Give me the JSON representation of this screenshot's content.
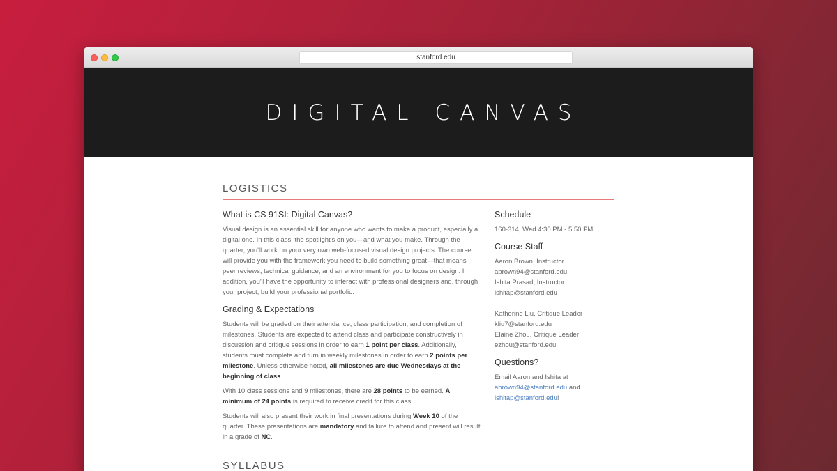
{
  "browser": {
    "url": "stanford.edu"
  },
  "hero": {
    "title": "DIGITAL CANVAS"
  },
  "logistics": {
    "section_title": "LOGISTICS",
    "what_is": {
      "heading": "What is CS 91SI: Digital Canvas?",
      "body": "Visual design is an essential skill for anyone who wants to make a product, especially a digital one. In this class, the spotlight's on you—and what you make. Through the quarter, you'll work on your very own web-focused visual design projects. The course will provide you with the framework you need to build something great—that means peer reviews, technical guidance, and an environment for you to focus on design. In addition, you'll have the opportunity to interact with professional designers and, through your project, build your professional portfolio."
    },
    "grading": {
      "heading": "Grading & Expectations",
      "p1_a": "Students will be graded on their attendance, class participation, and completion of milestones. Students are expected to attend class and participate constructively in discussion and critique sessions in order to earn ",
      "p1_b": "1 point per class",
      "p1_c": ". Additionally, students must complete and turn in weekly milestones in order to earn ",
      "p1_d": "2 points per milestone",
      "p1_e": ". Unless otherwise noted, ",
      "p1_f": "all milestones are due Wednesdays at the beginning of class",
      "p1_g": ".",
      "p2_a": "With 10 class sessions and 9 milestones, there are ",
      "p2_b": "28 points",
      "p2_c": " to be earned. ",
      "p2_d": "A minimum of 24 points",
      "p2_e": " is required to receive credit for this class.",
      "p3_a": "Students will also present their work in final presentations during ",
      "p3_b": "Week 10",
      "p3_c": " of the quarter. These presentations are ",
      "p3_d": "mandatory",
      "p3_e": " and failure to attend and present will result in a grade of ",
      "p3_f": "NC",
      "p3_g": "."
    },
    "schedule": {
      "heading": "Schedule",
      "text": "160-314, Wed 4:30 PM - 5:50 PM"
    },
    "staff": {
      "heading": "Course Staff",
      "members": [
        {
          "name": "Aaron Brown, Instructor",
          "email": "abrown94@stanford.edu"
        },
        {
          "name": "Ishita Prasad, Instructor",
          "email": "ishitap@stanford.edu"
        },
        {
          "name": "Katherine Liu, Critique Leader",
          "email": "kliu7@stanford.edu"
        },
        {
          "name": "Elaine Zhou, Critique Leader",
          "email": "ezhou@stanford.edu"
        }
      ]
    },
    "questions": {
      "heading": "Questions?",
      "text_a": "Email Aaron and Ishita at",
      "email1": "abrown94@stanford.edu",
      "text_b": " and",
      "email2": "ishitap@stanford.edu",
      "text_c": "!"
    }
  },
  "next_section": {
    "title": "SYLLABUS"
  }
}
